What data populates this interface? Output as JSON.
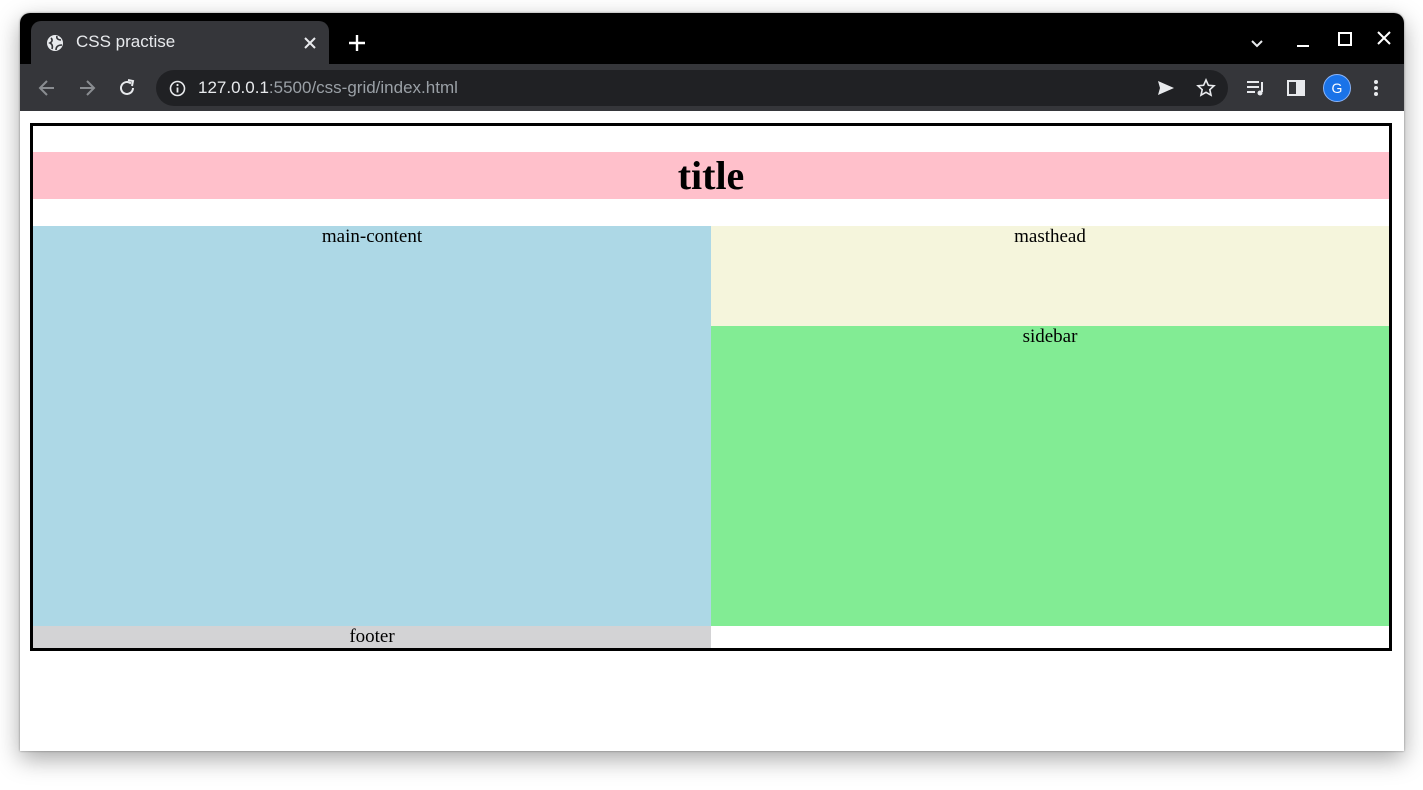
{
  "browser": {
    "tab_title": "CSS practise",
    "url_host": "127.0.0.1",
    "url_rest": ":5500/css-grid/index.html",
    "profile_initial": "G",
    "icons": [
      "globe-icon",
      "close-icon",
      "plus-icon",
      "chevron-down-icon",
      "minimize-icon",
      "maximize-icon",
      "close-window-icon",
      "back-icon",
      "forward-icon",
      "reload-icon",
      "info-icon",
      "send-icon",
      "star-icon",
      "media-queue-icon",
      "side-panel-icon",
      "more-vert-icon"
    ]
  },
  "page": {
    "title": "title",
    "main_content": "main-content",
    "masthead": "masthead",
    "sidebar": "sidebar",
    "footer": "footer"
  },
  "colors": {
    "title_bg": "#ffc0cb",
    "main_bg": "#add8e6",
    "masthead_bg": "#f5f5dc",
    "sidebar_bg": "#82ec94",
    "footer_bg": "#d3d3d5"
  }
}
